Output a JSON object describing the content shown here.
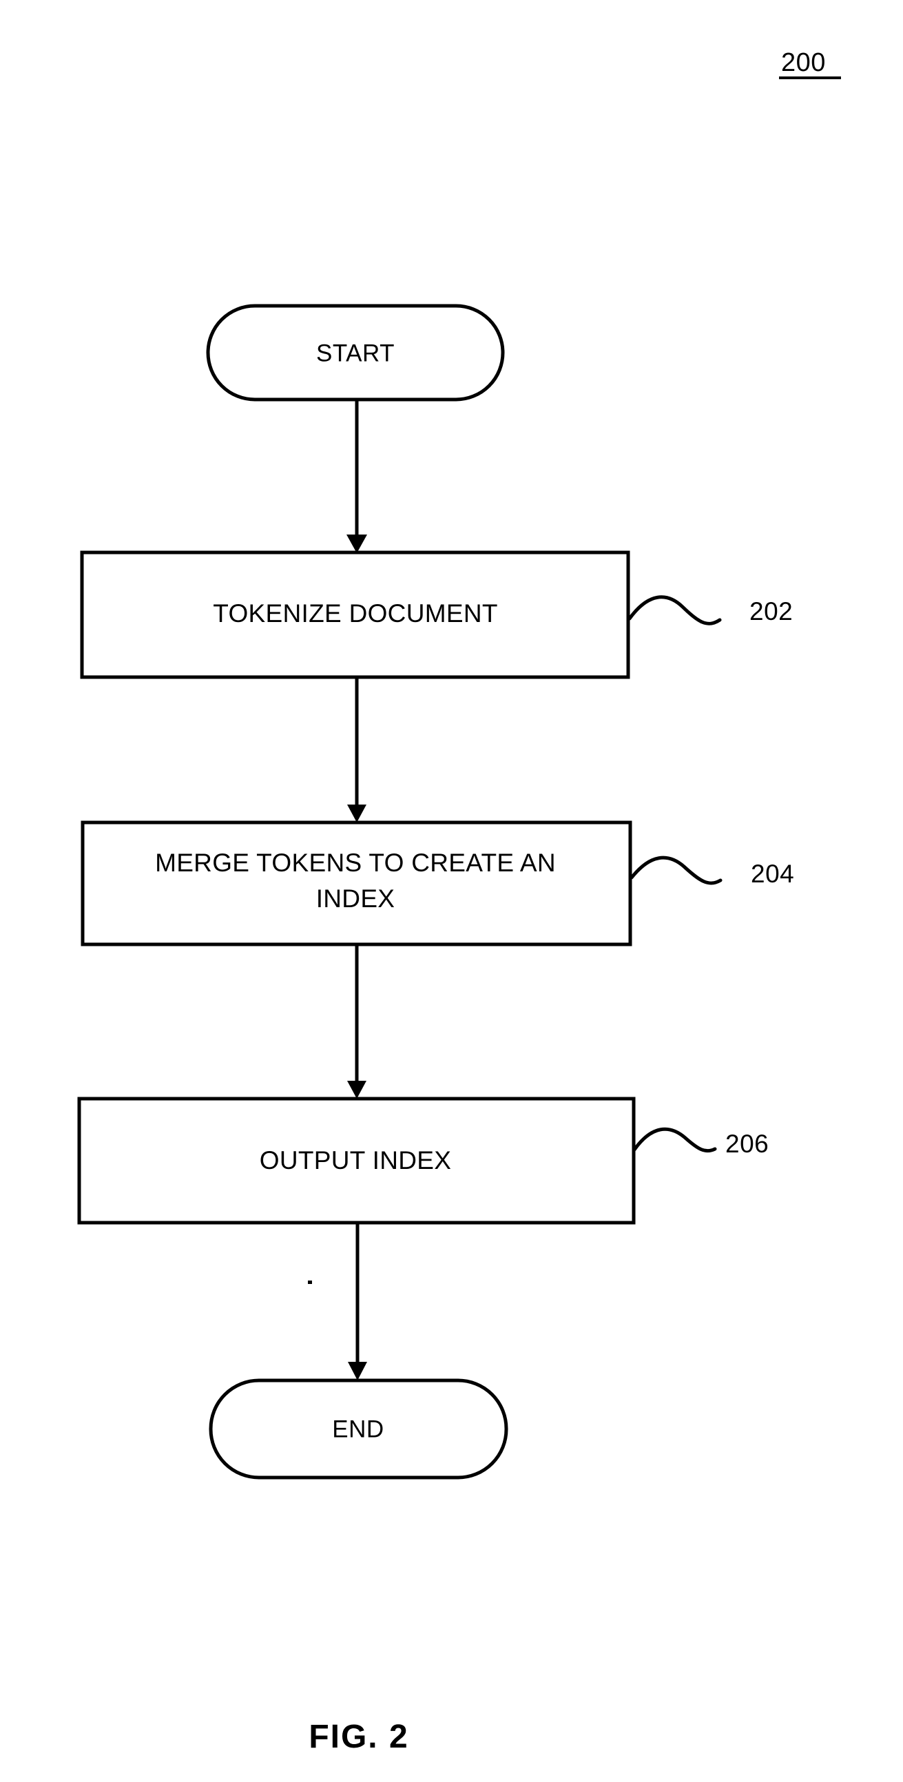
{
  "figure": {
    "sheet_reference": "200",
    "caption": "FIG. 2"
  },
  "nodes": [
    {
      "id": "start",
      "type": "terminator",
      "label": "START"
    },
    {
      "id": "tokenize",
      "type": "process",
      "label": "TOKENIZE DOCUMENT",
      "label_lines": [
        "TOKENIZE DOCUMENT"
      ],
      "reference": "202"
    },
    {
      "id": "merge",
      "type": "process",
      "label": "MERGE TOKENS TO CREATE AN INDEX",
      "label_lines": [
        "MERGE TOKENS TO CREATE AN",
        "INDEX"
      ],
      "reference": "204"
    },
    {
      "id": "output",
      "type": "process",
      "label": "OUTPUT INDEX",
      "label_lines": [
        "OUTPUT INDEX"
      ],
      "reference": "206"
    },
    {
      "id": "end",
      "type": "terminator",
      "label": "END"
    }
  ],
  "labels": {
    "start": "START",
    "tokenize": "TOKENIZE DOCUMENT",
    "merge_line1": "MERGE TOKENS TO CREATE AN",
    "merge_line2": "INDEX",
    "output": "OUTPUT INDEX",
    "end": "END",
    "ref_202": "202",
    "ref_204": "204",
    "ref_206": "206"
  },
  "colors": {
    "ink": "#000000",
    "paper": "#ffffff"
  }
}
